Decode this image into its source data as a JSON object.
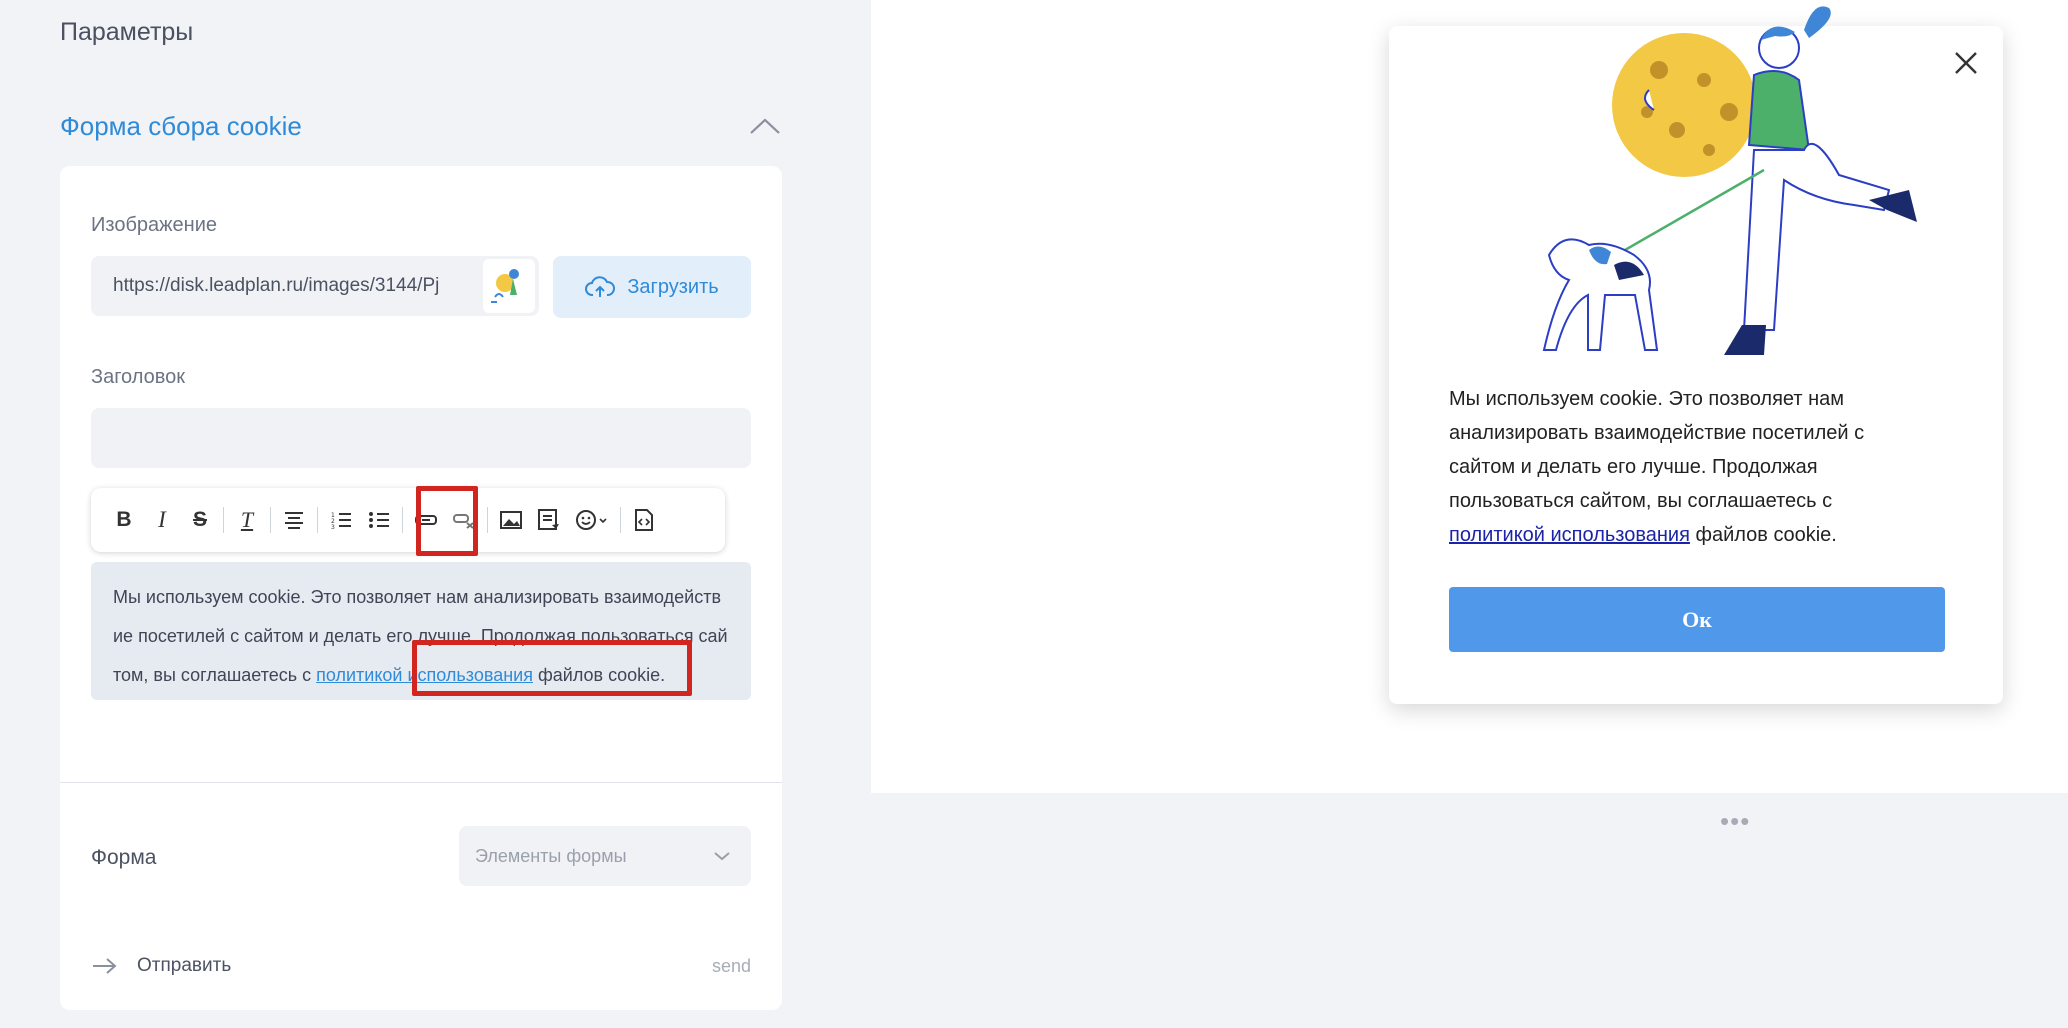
{
  "left": {
    "params_title": "Параметры",
    "section_title": "Форма сбора cookie",
    "image_label": "Изображение",
    "image_url": "https://disk.leadplan.ru/images/3144/Pj",
    "upload_label": "Загрузить",
    "heading_label": "Заголовок",
    "heading_value": "",
    "toolbar": {
      "bold": "B",
      "italic": "I",
      "strike": "S",
      "clear_format": "T"
    },
    "editor": {
      "before": "Мы используем cookie. Это позволяет нам анализировать взаимодействие посетилей с сайтом и делать его лучше. Продолжая пользоваться сайтом, вы соглашаетесь с ",
      "link": "политикой использования",
      "after": " файлов cookie."
    },
    "form_label": "Форма",
    "form_select": "Элементы формы",
    "send_label": "Отправить",
    "send_code": "send"
  },
  "preview": {
    "text_before": "Мы используем cookie. Это позволяет нам анализировать взаимодействие посетилей с сайтом и делать его лучше. Продолжая пользоваться сайтом, вы соглашаетесь с ",
    "link": "политикой использования",
    "text_after": " файлов cookie.",
    "ok_label": "Ок",
    "dots": "•••"
  },
  "colors": {
    "accent": "#2f8ad8",
    "highlight": "#d0261f",
    "ok_button": "#4f98ea",
    "cookie_yellow": "#f3c844"
  }
}
